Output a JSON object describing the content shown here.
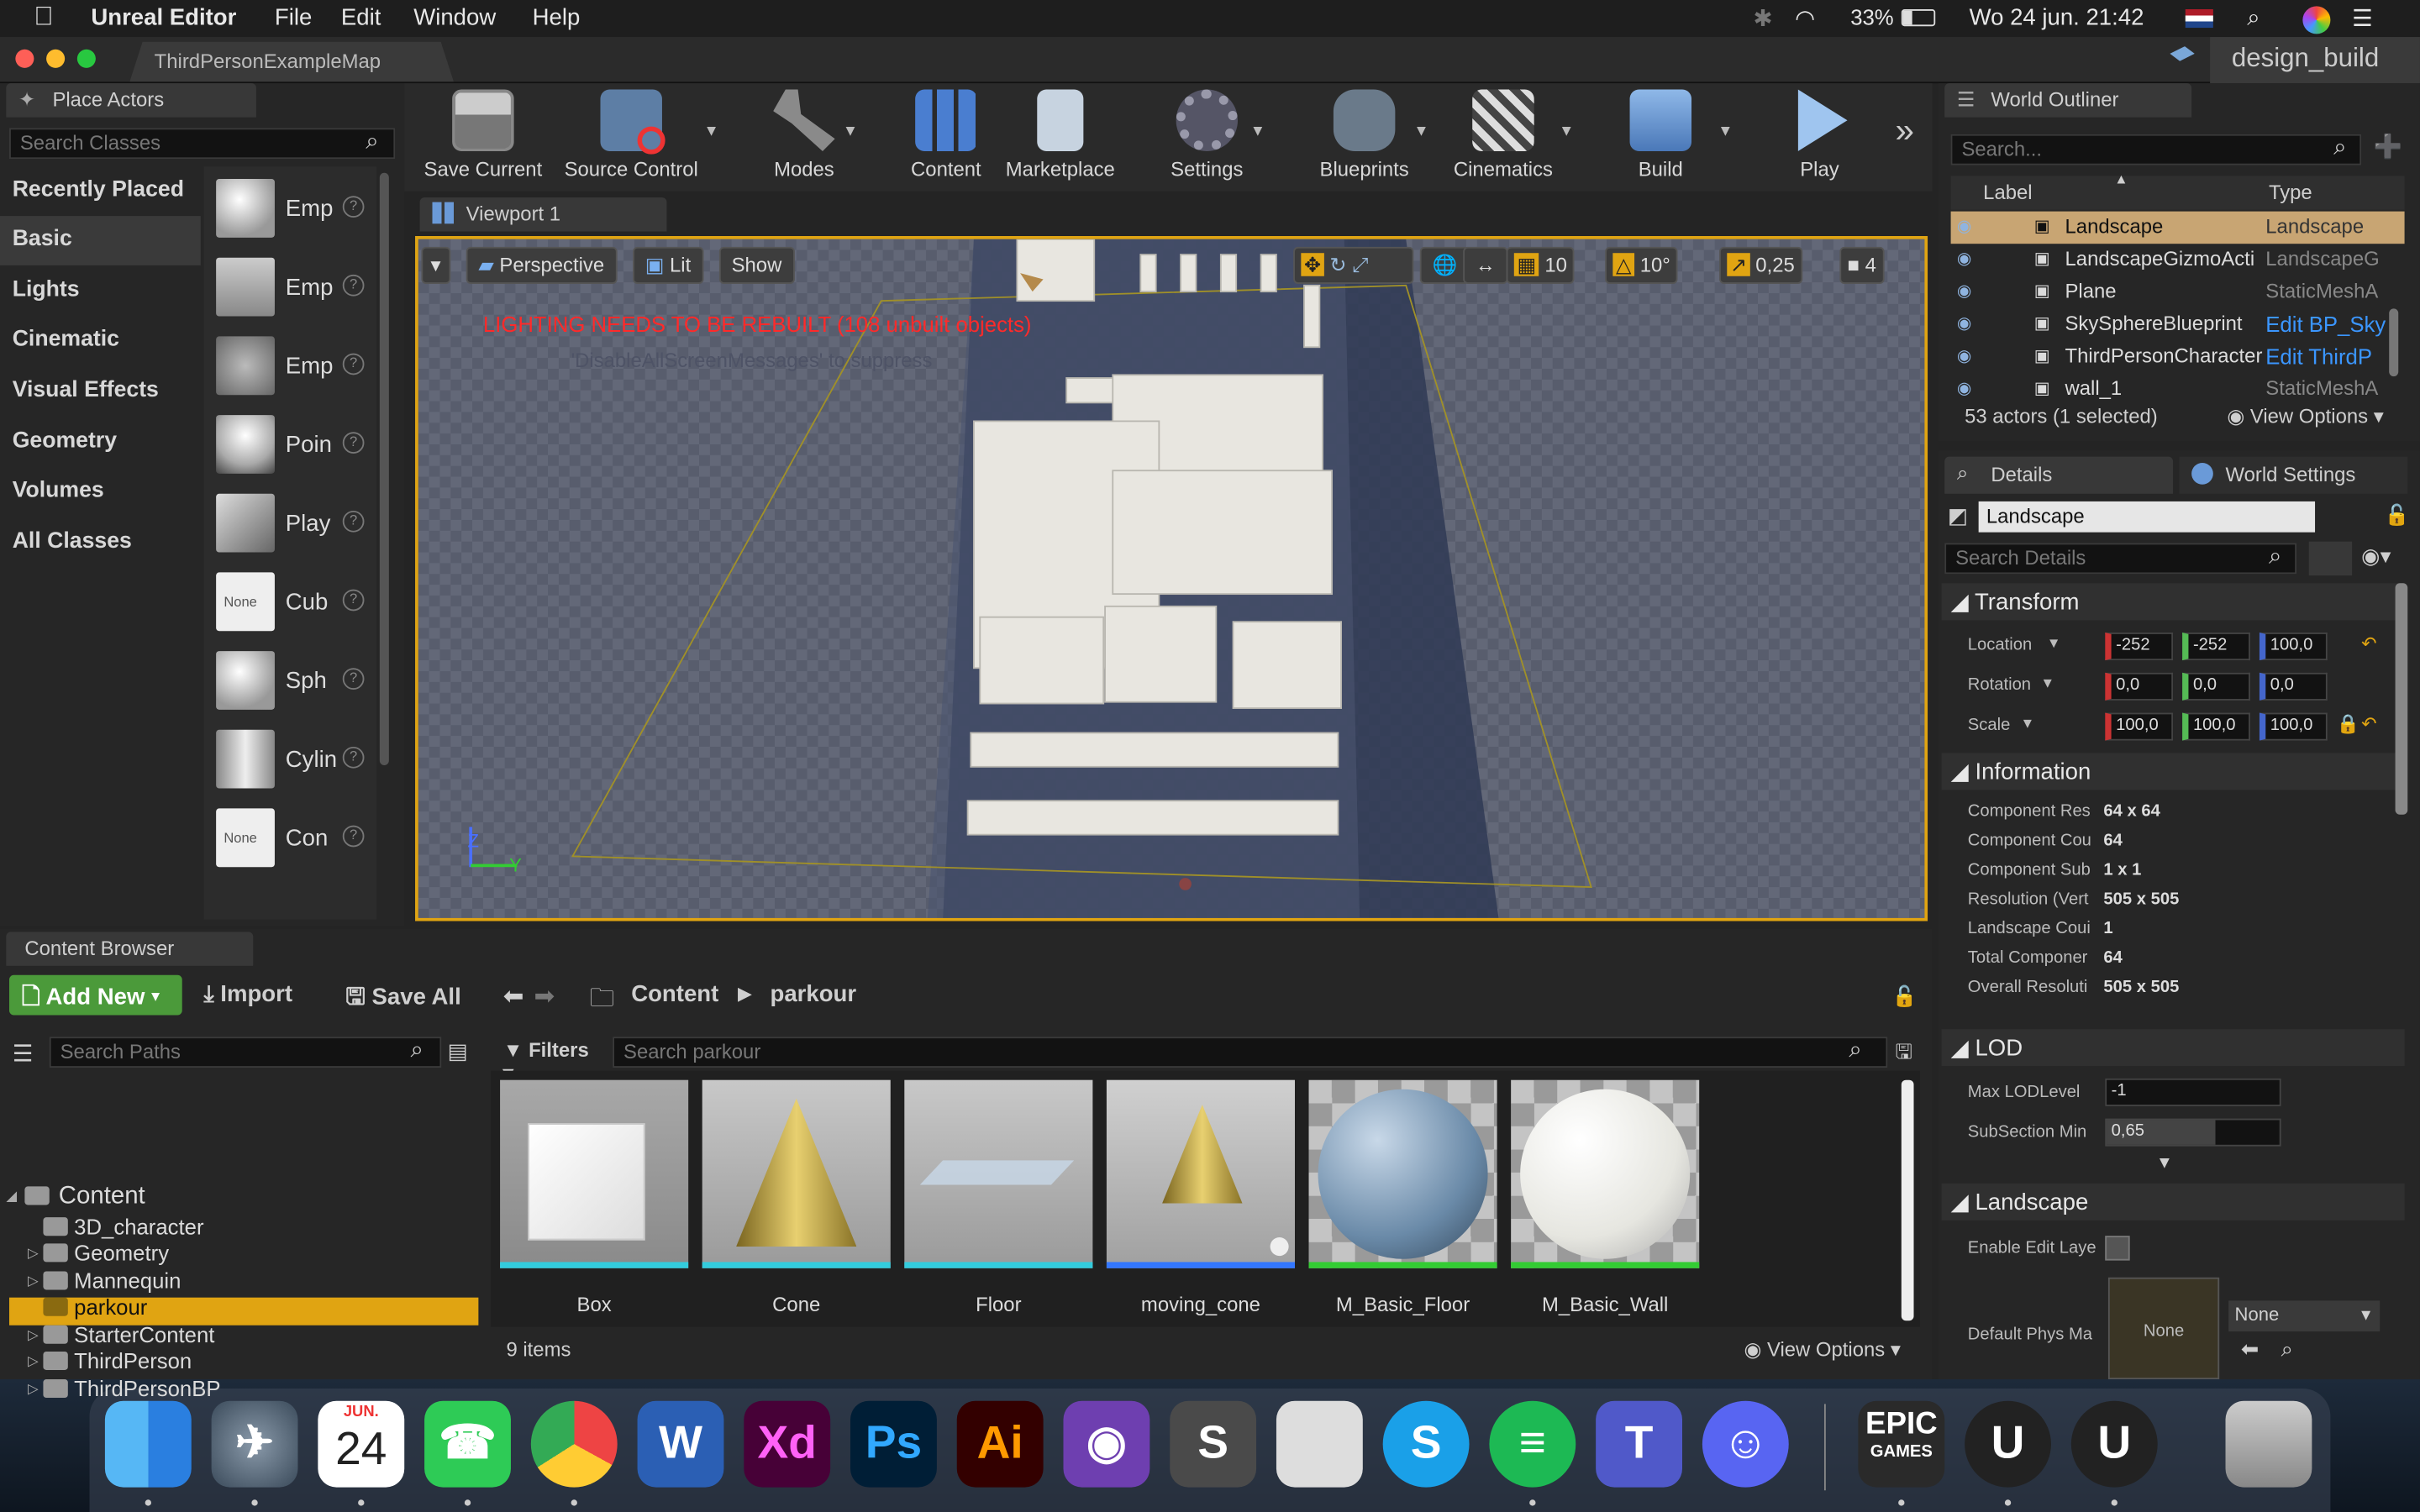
{
  "menubar": {
    "app": "Unreal Editor",
    "menus": [
      "File",
      "Edit",
      "Window",
      "Help"
    ],
    "battery": "33%",
    "datetime": "Wo 24 jun.  21:42"
  },
  "titlebar": {
    "tab": "ThirdPersonExampleMap",
    "project": "design_build"
  },
  "place_actors": {
    "title": "Place Actors",
    "search_placeholder": "Search Classes",
    "categories": [
      "Recently Placed",
      "Basic",
      "Lights",
      "Cinematic",
      "Visual Effects",
      "Geometry",
      "Volumes",
      "All Classes"
    ],
    "items": [
      "Emp",
      "Emp",
      "Emp",
      "Poin",
      "Play",
      "Cub",
      "Sph",
      "Cylin",
      "Con"
    ],
    "none_label": "None"
  },
  "toolbar": {
    "save_current": "Save Current",
    "source_control": "Source Control",
    "modes": "Modes",
    "content": "Content",
    "marketplace": "Marketplace",
    "settings": "Settings",
    "blueprints": "Blueprints",
    "cinematics": "Cinematics",
    "build": "Build",
    "play": "Play"
  },
  "viewport": {
    "tab": "Viewport 1",
    "perspective": "Perspective",
    "lit": "Lit",
    "show": "Show",
    "grid": "10",
    "angle": "10°",
    "scale": "0,25",
    "speed": "4",
    "warning": "LIGHTING NEEDS TO BE REBUILT (108 unbuilt objects)",
    "warning_sub": "'DisableAllScreenMessages' to suppress",
    "axis_z": "Z",
    "axis_y": "Y"
  },
  "outliner": {
    "title": "World Outliner",
    "search_placeholder": "Search...",
    "col_label": "Label",
    "col_type": "Type",
    "rows": [
      {
        "label": "Landscape",
        "type": "Landscape"
      },
      {
        "label": "LandscapeGizmoActi",
        "type": "LandscapeG"
      },
      {
        "label": "Plane",
        "type": "StaticMeshA"
      },
      {
        "label": "SkySphereBlueprint",
        "type": "Edit BP_Sky"
      },
      {
        "label": "ThirdPersonCharacter",
        "type": "Edit ThirdP"
      },
      {
        "label": "wall_1",
        "type": "StaticMeshA"
      }
    ],
    "count": "53 actors (1 selected)",
    "view_options": "View Options"
  },
  "details": {
    "tab": "Details",
    "tab2": "World Settings",
    "name": "Landscape",
    "search_placeholder": "Search Details",
    "transform": "Transform",
    "location": "Location",
    "rotation": "Rotation",
    "scale": "Scale",
    "loc_vals": [
      "-252",
      "-252",
      "100,0"
    ],
    "rot_vals": [
      "0,0",
      "0,0",
      "0,0"
    ],
    "scale_vals": [
      "100,0",
      "100,0",
      "100,0"
    ],
    "information": "Information",
    "info_rows": [
      {
        "k": "Component Res",
        "v": "64 x 64"
      },
      {
        "k": "Component Cou",
        "v": "64"
      },
      {
        "k": "Component Sub",
        "v": "1 x 1"
      },
      {
        "k": "Resolution (Vert",
        "v": "505 x 505"
      },
      {
        "k": "Landscape Coui",
        "v": "1"
      },
      {
        "k": "Total Componer",
        "v": "64"
      },
      {
        "k": "Overall Resoluti",
        "v": "505 x 505"
      }
    ],
    "lod": "LOD",
    "max_lod": "Max LODLevel",
    "max_lod_val": "-1",
    "subsection": "SubSection Min",
    "subsection_val": "0,65",
    "landscape": "Landscape",
    "enable_edit": "Enable Edit Laye",
    "default_phys": "Default Phys Ma",
    "none": "None",
    "none_select": "None"
  },
  "content_browser": {
    "title": "Content Browser",
    "add_new": "Add New",
    "import": "Import",
    "save_all": "Save All",
    "crumb_root": "Content",
    "crumb_leaf": "parkour",
    "search_paths": "Search Paths",
    "filters": "Filters",
    "search_placeholder": "Search parkour",
    "tree": [
      "Content",
      "3D_character",
      "Geometry",
      "Mannequin",
      "parkour",
      "StarterContent",
      "ThirdPerson",
      "ThirdPersonBP"
    ],
    "assets": [
      "Box",
      "Cone",
      "Floor",
      "moving_cone",
      "M_Basic_Floor",
      "M_Basic_Wall"
    ],
    "count": "9 items",
    "view_options": "View Options"
  },
  "dock": {
    "calendar_month": "JUN.",
    "calendar_day": "24",
    "apps": [
      "finder",
      "launchpad",
      "calendar",
      "whatsapp",
      "chrome",
      "word",
      "xd",
      "photoshop",
      "illustrator",
      "github",
      "sublime",
      "calculator",
      "skype",
      "spotify",
      "teams",
      "discord",
      "epic",
      "unreal",
      "unreal",
      "trash"
    ],
    "labels": {
      "word": "W",
      "xd": "Xd",
      "ps": "Ps",
      "ai": "Ai",
      "epic1": "EPIC",
      "epic2": "GAMES",
      "ue": "U"
    }
  }
}
